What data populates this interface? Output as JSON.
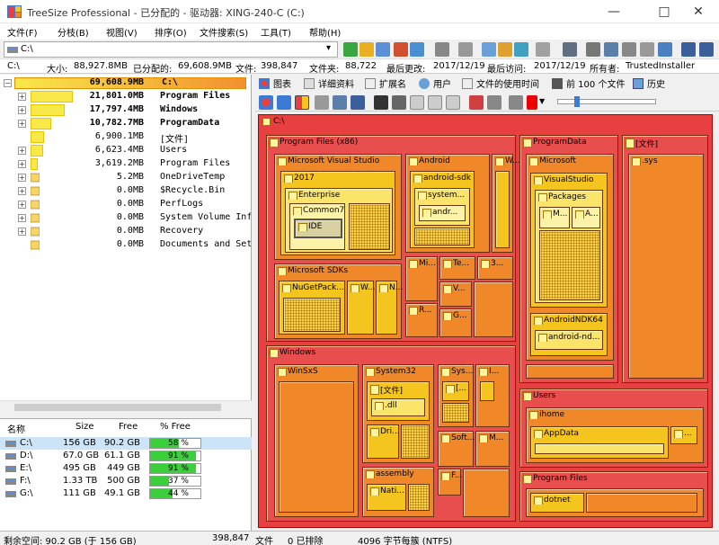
{
  "window": {
    "title": "TreeSize Professional - 已分配的 - 驱动器: XING-240-C (C:)",
    "minimize_icon": "minimize-icon",
    "maximize_icon": "maximize-icon",
    "close_icon": "close-icon"
  },
  "menu": [
    "文件(F)",
    "分枝(B)",
    "视图(V)",
    "排序(O)",
    "文件搜索(S)",
    "工具(T)",
    "帮助(H)"
  ],
  "toolbar": {
    "path": "C:\\"
  },
  "info": {
    "drive": "C:\\",
    "size_label": "大小:",
    "size_value": "88,927.8MB",
    "alloc_label": "已分配的:",
    "alloc_value": "69,608.9MB",
    "files_label": "文件:",
    "files_value": "398,847",
    "folders_label": "文件夹:",
    "folders_value": "88,722",
    "modified_label": "最后更改:",
    "modified_value": "2017/12/19",
    "accessed_label": "最后访问:",
    "accessed_value": "2017/12/19",
    "owner_label": "所有者:",
    "owner_value": "TrustedInstaller"
  },
  "tree": {
    "root": {
      "size": "69,608.9MB",
      "name": "C:\\",
      "fraction": 1.0
    },
    "items": [
      {
        "size": "21,801.0MB",
        "name": "Program Files",
        "fraction": 0.313,
        "bold": true,
        "expand": "+"
      },
      {
        "size": "17,797.4MB",
        "name": "Windows",
        "fraction": 0.256,
        "bold": true,
        "expand": "+"
      },
      {
        "size": "10,782.7MB",
        "name": "ProgramData",
        "fraction": 0.155,
        "bold": true,
        "expand": "+"
      },
      {
        "size": "6,900.1MB",
        "name": "[文件]",
        "fraction": 0.099,
        "bold": false,
        "expand": ""
      },
      {
        "size": "6,623.4MB",
        "name": "Users",
        "fraction": 0.095,
        "bold": false,
        "expand": "+"
      },
      {
        "size": "3,619.2MB",
        "name": "Program Files",
        "fraction": 0.052,
        "bold": false,
        "expand": "+"
      },
      {
        "size": "5.2MB",
        "name": "OneDriveTemp",
        "fraction": 0,
        "bold": false,
        "expand": "+"
      },
      {
        "size": "0.0MB",
        "name": "$Recycle.Bin",
        "fraction": 0,
        "bold": false,
        "expand": "+"
      },
      {
        "size": "0.0MB",
        "name": "PerfLogs",
        "fraction": 0,
        "bold": false,
        "expand": "+"
      },
      {
        "size": "0.0MB",
        "name": "System Volume Inform",
        "fraction": 0,
        "bold": false,
        "expand": "+"
      },
      {
        "size": "0.0MB",
        "name": "Recovery",
        "fraction": 0,
        "bold": false,
        "expand": "+"
      },
      {
        "size": "0.0MB",
        "name": "Documents and Settin",
        "fraction": 0,
        "bold": false,
        "expand": ""
      }
    ]
  },
  "drives": {
    "headers": [
      "名称",
      "Size",
      "Free",
      "% Free"
    ],
    "rows": [
      {
        "name": "C:\\",
        "size": "156 GB",
        "free": "90.2 GB",
        "pct": "58 %",
        "fraction": 0.58,
        "selected": true
      },
      {
        "name": "D:\\",
        "size": "67.0 GB",
        "free": "61.1 GB",
        "pct": "91 %",
        "fraction": 0.91,
        "selected": false
      },
      {
        "name": "E:\\",
        "size": "495 GB",
        "free": "449 GB",
        "pct": "91 %",
        "fraction": 0.91,
        "selected": false
      },
      {
        "name": "F:\\",
        "size": "1.33 TB",
        "free": "500 GB",
        "pct": "37 %",
        "fraction": 0.37,
        "selected": false
      },
      {
        "name": "G:\\",
        "size": "111 GB",
        "free": "49.1 GB",
        "pct": "44 %",
        "fraction": 0.44,
        "selected": false
      }
    ]
  },
  "tabs": [
    "图表",
    "详细资料",
    "扩展名",
    "用户",
    "文件的使用时间",
    "前 100 个文件",
    "历史"
  ],
  "treemap": {
    "root": "C:\\",
    "labels": {
      "pf86": "Program Files (x86)",
      "msvs": "Microsoft Visual Studio",
      "y2017": "2017",
      "enterprise": "Enterprise",
      "common7": "Common7",
      "ide": "IDE",
      "android": "Android",
      "androidsdk": "android-sdk",
      "system": "system...",
      "andr": "andr...",
      "w": "W...",
      "mi": "Mi...",
      "te": "Te...",
      "three": "3...",
      "v": "V...",
      "r": "R...",
      "g": "G...",
      "mssdks": "Microsoft SDKs",
      "nuget": "NuGetPack...",
      "w2": "W...",
      "n": "N...",
      "programdata": "ProgramData",
      "microsoft": "Microsoft",
      "visualstudio": "VisualStudio",
      "packages": "Packages",
      "m": "M...",
      "a": "A...",
      "ndk": "AndroidNDK64",
      "andnd": "android-nd...",
      "files": "[文件]",
      "sys": ".sys",
      "windows": "Windows",
      "winsxs": "WinSxS",
      "system32": "System32",
      "files2": "[文件]",
      "dll": ".dll",
      "dri": "Dri...",
      "sys2": "Sys...",
      "i": "I...",
      "bracket": "[...",
      "soft": "Soft...",
      "m2": "M...",
      "assembly": "assembly",
      "nati": "Nati...",
      "f": "F...",
      "users": "Users",
      "ihome": "ihome",
      "appdata": "AppData",
      "dots": "...",
      "pf": "Program Files",
      "dotnet": "dotnet"
    }
  },
  "status": {
    "free": "剩余空间: 90.2 GB  (于 156 GB)",
    "files_count": "398,847",
    "files_label": "文件",
    "excluded": "0 已排除",
    "cluster": "4096 字节每簇 (NTFS)"
  }
}
